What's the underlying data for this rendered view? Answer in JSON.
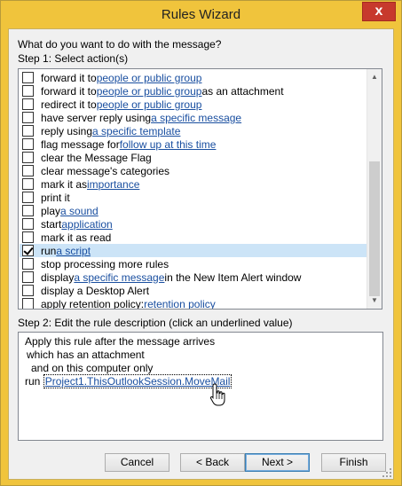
{
  "window": {
    "title": "Rules Wizard",
    "close_glyph": "x"
  },
  "question": "What do you want to do with the message?",
  "step1_label": "Step 1: Select action(s)",
  "actions": [
    {
      "checked": false,
      "pre": "forward it to ",
      "link": "people or public group",
      "post": ""
    },
    {
      "checked": false,
      "pre": "forward it to ",
      "link": "people or public group",
      "post": " as an attachment"
    },
    {
      "checked": false,
      "pre": "redirect it to ",
      "link": "people or public group",
      "post": ""
    },
    {
      "checked": false,
      "pre": "have server reply using ",
      "link": "a specific message",
      "post": ""
    },
    {
      "checked": false,
      "pre": "reply using ",
      "link": "a specific template",
      "post": ""
    },
    {
      "checked": false,
      "pre": "flag message for ",
      "link": "follow up at this time",
      "post": ""
    },
    {
      "checked": false,
      "pre": "clear the Message Flag",
      "link": "",
      "post": ""
    },
    {
      "checked": false,
      "pre": "clear message's categories",
      "link": "",
      "post": ""
    },
    {
      "checked": false,
      "pre": "mark it as ",
      "link": "importance",
      "post": ""
    },
    {
      "checked": false,
      "pre": "print it",
      "link": "",
      "post": ""
    },
    {
      "checked": false,
      "pre": "play ",
      "link": "a sound",
      "post": ""
    },
    {
      "checked": false,
      "pre": "start ",
      "link": "application",
      "post": ""
    },
    {
      "checked": false,
      "pre": "mark it as read",
      "link": "",
      "post": ""
    },
    {
      "checked": true,
      "selected": true,
      "pre": "run ",
      "link": "a script",
      "post": ""
    },
    {
      "checked": false,
      "pre": "stop processing more rules",
      "link": "",
      "post": ""
    },
    {
      "checked": false,
      "pre": "display ",
      "link": "a specific message",
      "post": " in the New Item Alert window"
    },
    {
      "checked": false,
      "pre": "display a Desktop Alert",
      "link": "",
      "post": ""
    },
    {
      "checked": false,
      "pre": "apply retention policy: ",
      "link": "retention policy",
      "post": ""
    }
  ],
  "step2_label": "Step 2: Edit the rule description (click an underlined value)",
  "description": {
    "line1": "Apply this rule after the message arrives",
    "line2": "which has an attachment",
    "line3": "and on this computer only",
    "line4_pre": "run ",
    "line4_link": "Project1.ThisOutlookSession.MoveMail"
  },
  "buttons": {
    "cancel": "Cancel",
    "back": "< Back",
    "next": "Next >",
    "finish": "Finish"
  },
  "icons": {
    "close": "close-icon",
    "checkbox_checked": "checkmark-icon",
    "scroll_up": "chevron-up-icon",
    "scroll_down": "chevron-down-icon",
    "cursor": "hand-pointer-icon",
    "resize": "resize-grip-icon"
  },
  "colors": {
    "title_bar": "#f0c43c",
    "link": "#1a4fa0",
    "selected_row": "#cce4f7",
    "close_button": "#c7392d"
  }
}
